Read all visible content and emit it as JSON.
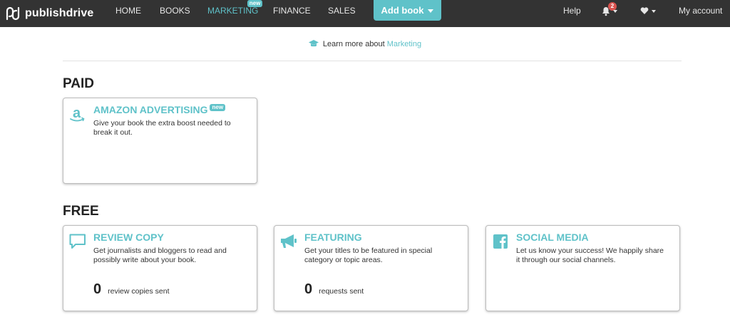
{
  "brand": {
    "name": "publishdrive"
  },
  "nav": {
    "items": [
      {
        "label": "HOME"
      },
      {
        "label": "BOOKS"
      },
      {
        "label": "MARKETING",
        "badge": "new",
        "active": true
      },
      {
        "label": "FINANCE"
      },
      {
        "label": "SALES"
      }
    ],
    "add_book": "Add book",
    "help": "Help",
    "notifications_count": "2",
    "account": "My account"
  },
  "learn": {
    "prefix": "Learn more about",
    "link": "Marketing"
  },
  "paid": {
    "title": "PAID",
    "cards": [
      {
        "title": "AMAZON ADVERTISING",
        "badge": "new",
        "icon": "amazon-icon",
        "desc": "Give your book the extra boost needed to break it out."
      }
    ]
  },
  "free": {
    "title": "FREE",
    "cards": [
      {
        "title": "REVIEW COPY",
        "icon": "speech-bubble-icon",
        "desc": "Get journalists and bloggers to read and possibly write about your book.",
        "stat_value": "0",
        "stat_label": "review copies sent"
      },
      {
        "title": "FEATURING",
        "icon": "megaphone-icon",
        "desc": "Get your titles to be featured in special category or topic areas.",
        "stat_value": "0",
        "stat_label": "requests sent"
      },
      {
        "title": "SOCIAL MEDIA",
        "icon": "facebook-icon",
        "desc": "Let us know your success! We happily share it through our social channels."
      }
    ]
  },
  "colors": {
    "accent": "#5fc2c9",
    "topbar": "#333333",
    "badge_red": "#d9534f"
  }
}
